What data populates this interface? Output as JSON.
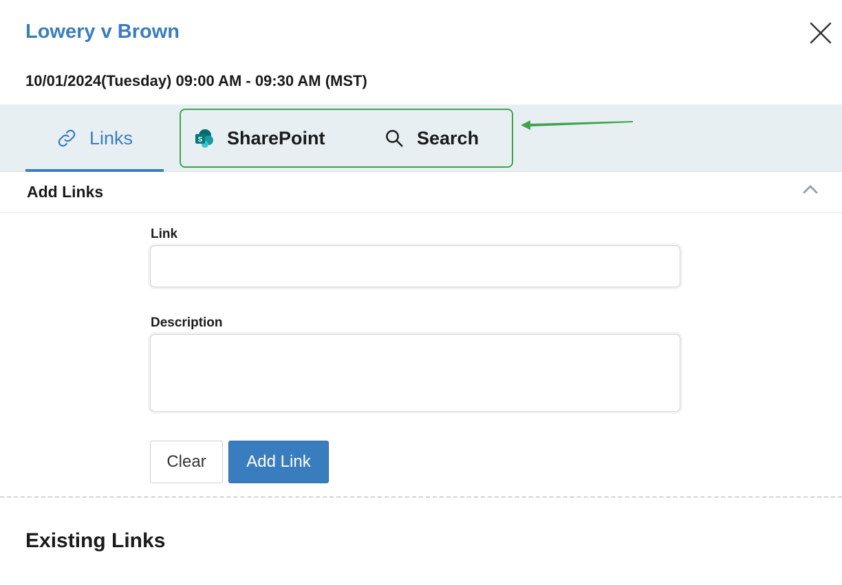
{
  "header": {
    "title": "Lowery v Brown",
    "datetime": "10/01/2024(Tuesday)  09:00 AM - 09:30 AM (MST)",
    "close_icon": "close-icon"
  },
  "tabs": [
    {
      "label": "Links",
      "icon": "link-icon",
      "active": true
    },
    {
      "label": "SharePoint",
      "icon": "sharepoint-icon",
      "active": false
    },
    {
      "label": "Search",
      "icon": "search-icon",
      "active": false
    }
  ],
  "section": {
    "title": "Add Links",
    "collapse_icon": "chevron-up-icon"
  },
  "form": {
    "link_label": "Link",
    "link_value": "",
    "description_label": "Description",
    "description_value": "",
    "clear_label": "Clear",
    "add_label": "Add Link"
  },
  "existing": {
    "title": "Existing Links"
  },
  "colors": {
    "accent": "#3a7dbf",
    "tabbar": "#e8eff3",
    "highlight": "#3fa34d"
  }
}
